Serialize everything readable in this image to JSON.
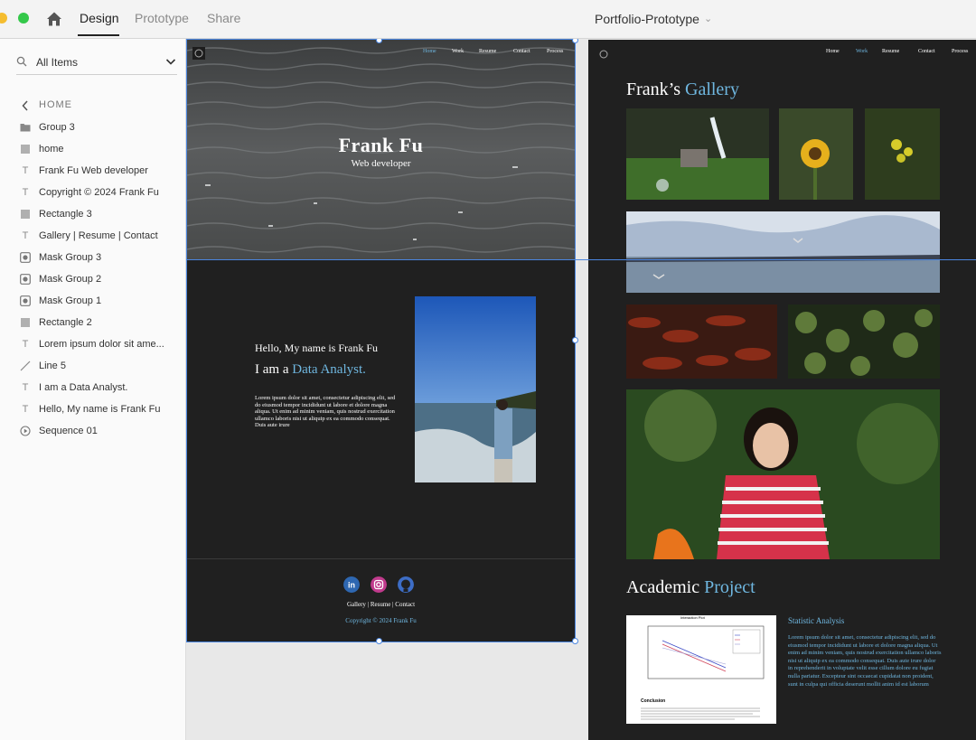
{
  "window": {
    "traffic_lights": [
      "#f5bd30",
      "#34c84a"
    ]
  },
  "toolbar": {
    "tabs": [
      {
        "label": "Design",
        "active": true
      },
      {
        "label": "Prototype",
        "active": false
      },
      {
        "label": "Share",
        "active": false
      }
    ],
    "document_title": "Portfolio-Prototype"
  },
  "layers": {
    "search_label": "All Items",
    "back_label": "HOME",
    "items": [
      {
        "label": "Group 3",
        "icon": "folder-icon"
      },
      {
        "label": "home",
        "icon": "rectangle-icon"
      },
      {
        "label": "Frank Fu Web developer",
        "icon": "text-icon"
      },
      {
        "label": "Copyright © 2024 Frank Fu",
        "icon": "text-icon"
      },
      {
        "label": "Rectangle 3",
        "icon": "rectangle-icon"
      },
      {
        "label": "Gallery | Resume | Contact",
        "icon": "text-icon"
      },
      {
        "label": "Mask Group 3",
        "icon": "mask-icon"
      },
      {
        "label": "Mask Group 2",
        "icon": "mask-icon"
      },
      {
        "label": "Mask Group 1",
        "icon": "mask-icon"
      },
      {
        "label": "Rectangle 2",
        "icon": "rectangle-icon"
      },
      {
        "label": "Lorem ipsum dolor sit ame...",
        "icon": "text-icon"
      },
      {
        "label": "Line 5",
        "icon": "line-icon"
      },
      {
        "label": "I am a Data Analyst.",
        "icon": "text-icon"
      },
      {
        "label": "Hello, My name is Frank Fu",
        "icon": "text-icon"
      },
      {
        "label": "Sequence 01",
        "icon": "play-icon"
      }
    ]
  },
  "artboard_home": {
    "nav": [
      "Home",
      "Work",
      "Resume",
      "Contact",
      "Process"
    ],
    "nav_active": "Home",
    "hero_title": "Frank Fu",
    "hero_subtitle": "Web developer",
    "hello": "Hello, My name is Frank Fu",
    "analyst_prefix": "I am a ",
    "analyst_highlight": "Data Analyst.",
    "lorem": "Lorem ipsum dolor sit amet, consectetur adipiscing elit, sed do eiusmod tempor incididunt ut labore et dolore magna aliqua. Ut enim ad minim veniam, quis nostrud exercitation ullamco laboris nisi ut aliquip ex ea commodo consequat. Duis aute irure",
    "social_icons": [
      "linkedin-icon",
      "instagram-icon",
      "github-icon"
    ],
    "footer_links": "Gallery | Resume | Contact",
    "copyright": "Copyright © 2024 Frank Fu"
  },
  "artboard_gallery": {
    "nav": [
      "Home",
      "Work",
      "Resume",
      "Contact",
      "Process"
    ],
    "nav_active": "Work",
    "gallery_title_prefix": "Frank’s ",
    "gallery_title_highlight": "Gallery",
    "photos": [
      "fountain-photo",
      "sunflower-photo",
      "yellow-flower-photo",
      "seagulls-lake-photo",
      "red-chilies-photo",
      "lily-pads-photo",
      "girl-portrait-photo"
    ],
    "academic_title_prefix": "Academic ",
    "academic_title_highlight": "Project",
    "stat_title": "Statistic Analysis",
    "stat_lorem": "Lorem ipsum dolor sit amet, consectetur adipiscing elit, sed do eiusmod tempor incididunt ut labore et dolore magna aliqua. Ut enim ad minim veniam, quis nostrud exercitation ullamco laboris nisi ut aliquip ex ea commodo consequat. Duis aute irure dolor in reprehenderit in voluptate velit esse cillum dolore eu fugiat nulla pariatur. Excepteur sint occaecat cupidatat non proident, sunt in culpa qui officia deserunt mollit anim id est laborum",
    "report_chart_title": "Interaction Plot",
    "report_conclusion": "Conclusion"
  },
  "colors": {
    "accent": "#6fb7e0",
    "selection": "#4b86e0",
    "artboard_bg": "#202020"
  }
}
